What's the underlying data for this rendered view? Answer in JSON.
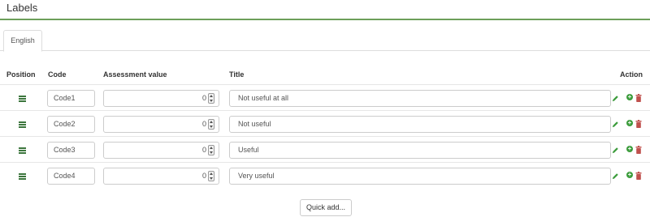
{
  "header": {
    "title": "Labels"
  },
  "tabs": [
    {
      "label": "English",
      "active": true
    }
  ],
  "table": {
    "columns": {
      "position": "Position",
      "code": "Code",
      "assessment": "Assessment value",
      "title": "Title",
      "action": "Action"
    },
    "rows": [
      {
        "code": "Code1",
        "assessment": "0",
        "title": "Not useful at all"
      },
      {
        "code": "Code2",
        "assessment": "0",
        "title": "Not useful"
      },
      {
        "code": "Code3",
        "assessment": "0",
        "title": "Useful"
      },
      {
        "code": "Code4",
        "assessment": "0",
        "title": "Very useful"
      }
    ]
  },
  "buttons": {
    "quick_add": "Quick add..."
  },
  "icons": {
    "drag": "drag-handle-icon",
    "edit": "pencil-icon",
    "add": "plus-circle-icon",
    "delete": "trash-icon"
  },
  "colors": {
    "accent": "#6c9f5a",
    "add_icon": "#3c9c3c",
    "delete_icon": "#c0504d",
    "edit_icon": "#3c9c3c"
  }
}
